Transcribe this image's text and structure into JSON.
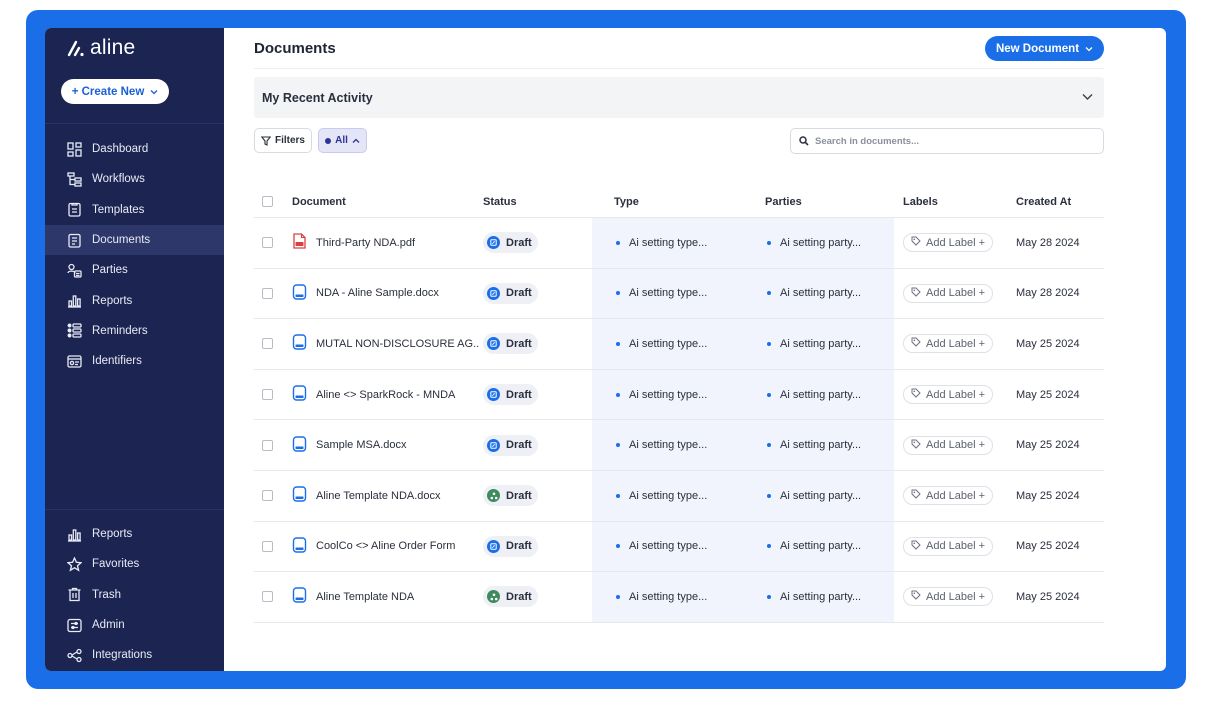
{
  "brand": {
    "name": "aline"
  },
  "sidebar": {
    "create_label": "+ Create New",
    "nav": [
      {
        "label": "Dashboard",
        "icon": "dashboard-icon"
      },
      {
        "label": "Workflows",
        "icon": "workflow-icon"
      },
      {
        "label": "Templates",
        "icon": "template-icon"
      },
      {
        "label": "Documents",
        "icon": "document-icon",
        "active": true
      },
      {
        "label": "Parties",
        "icon": "parties-icon"
      },
      {
        "label": "Reports",
        "icon": "reports-icon"
      },
      {
        "label": "Reminders",
        "icon": "reminders-icon"
      },
      {
        "label": "Identifiers",
        "icon": "identifiers-icon"
      }
    ],
    "bottom_nav": [
      {
        "label": "Reports",
        "icon": "reports-icon"
      },
      {
        "label": "Favorites",
        "icon": "star-icon"
      },
      {
        "label": "Trash",
        "icon": "trash-icon"
      },
      {
        "label": "Admin",
        "icon": "admin-icon"
      },
      {
        "label": "Integrations",
        "icon": "integrations-icon"
      }
    ]
  },
  "header": {
    "title": "Documents",
    "new_document_label": "New Document"
  },
  "activity": {
    "title": "My Recent Activity"
  },
  "toolbar": {
    "filters_label": "Filters",
    "all_label": "All",
    "search_placeholder": "Search in documents..."
  },
  "table": {
    "columns": {
      "document": "Document",
      "status": "Status",
      "type": "Type",
      "parties": "Parties",
      "labels": "Labels",
      "created": "Created At"
    },
    "rows": [
      {
        "name": "Third-Party NDA.pdf",
        "file": "pdf",
        "status": "Draft",
        "status_kind": "edit",
        "type": "Ai setting type...",
        "parties": "Ai setting party...",
        "label": "Add Label +",
        "created": "May 28 2024"
      },
      {
        "name": "NDA - Aline Sample.docx",
        "file": "doc",
        "status": "Draft",
        "status_kind": "edit",
        "type": "Ai setting type...",
        "parties": "Ai setting party...",
        "label": "Add Label +",
        "created": "May 28 2024"
      },
      {
        "name": "MUTAL NON-DISCLOSURE AG..",
        "file": "doc",
        "status": "Draft",
        "status_kind": "edit",
        "type": "Ai setting type...",
        "parties": "Ai setting party...",
        "label": "Add Label +",
        "created": "May 25 2024"
      },
      {
        "name": "Aline <> SparkRock - MNDA",
        "file": "doc",
        "status": "Draft",
        "status_kind": "edit",
        "type": "Ai setting type...",
        "parties": "Ai setting party...",
        "label": "Add Label +",
        "created": "May 25 2024"
      },
      {
        "name": "Sample MSA.docx",
        "file": "doc",
        "status": "Draft",
        "status_kind": "edit",
        "type": "Ai setting type...",
        "parties": "Ai setting party...",
        "label": "Add Label +",
        "created": "May 25 2024"
      },
      {
        "name": "Aline Template NDA.docx",
        "file": "doc",
        "status": "Draft",
        "status_kind": "workflow",
        "type": "Ai setting type...",
        "parties": "Ai setting party...",
        "label": "Add Label +",
        "created": "May 25 2024"
      },
      {
        "name": "CoolCo <> Aline Order Form",
        "file": "doc",
        "status": "Draft",
        "status_kind": "edit",
        "type": "Ai setting type...",
        "parties": "Ai setting party...",
        "label": "Add Label +",
        "created": "May 25 2024"
      },
      {
        "name": "Aline Template NDA",
        "file": "doc",
        "status": "Draft",
        "status_kind": "workflow",
        "type": "Ai setting type...",
        "parties": "Ai setting party...",
        "label": "Add Label +",
        "created": "May 25 2024"
      }
    ]
  },
  "colors": {
    "frame": "#1a6fe8",
    "sidebar": "#1c2552",
    "accent": "#1a6fe8",
    "workflow_status": "#3f8a5e",
    "pdf": "#d94141"
  }
}
